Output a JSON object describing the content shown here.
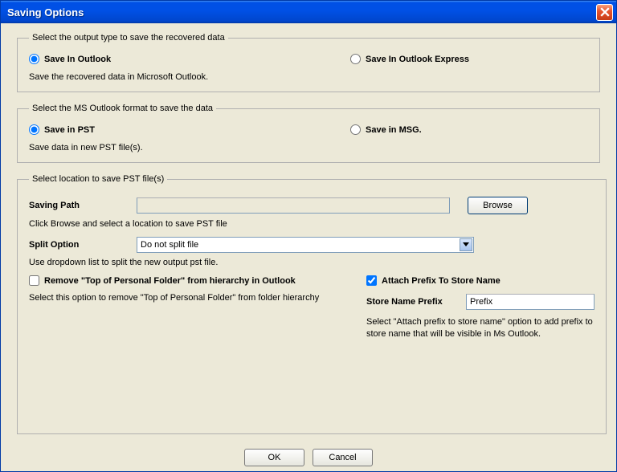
{
  "window": {
    "title": "Saving Options"
  },
  "group1": {
    "legend": "Select the output type to save the recovered data",
    "opt1": "Save In Outlook",
    "opt2": "Save In Outlook Express",
    "desc": "Save the recovered data in Microsoft Outlook."
  },
  "group2": {
    "legend": "Select the MS Outlook format to save the data",
    "opt1": "Save in PST",
    "opt2": "Save in MSG.",
    "desc": "Save data in new PST file(s)."
  },
  "group3": {
    "legend": "Select location to save PST file(s)",
    "savingPathLabel": "Saving Path",
    "savingPathValue": "",
    "browse": "Browse",
    "browseDesc": "Click Browse and select a location to save PST file",
    "splitLabel": "Split Option",
    "splitSelected": "Do not split file",
    "splitDesc": "Use dropdown list to split the new output pst file.",
    "removeTopLabel": "Remove \"Top of Personal Folder\" from hierarchy in Outlook",
    "removeTopDesc": "Select this option to remove \"Top of Personal Folder\" from folder hierarchy",
    "attachPrefixLabel": "Attach Prefix To Store Name",
    "storeNamePrefixLabel": "Store Name Prefix",
    "storeNamePrefixValue": "Prefix",
    "attachPrefixDesc": "Select \"Attach prefix to store name\" option to add prefix to store name that will be visible in Ms Outlook."
  },
  "buttons": {
    "ok": "OK",
    "cancel": "Cancel"
  }
}
